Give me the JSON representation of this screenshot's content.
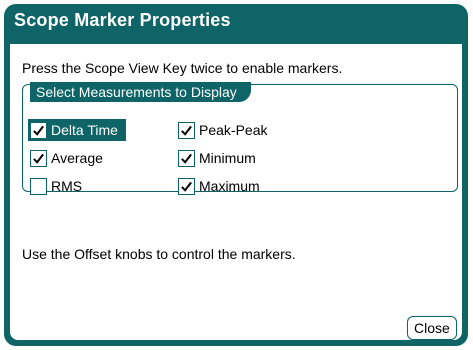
{
  "dialog": {
    "title": "Scope Marker Properties",
    "instruction": "Press the Scope View Key twice to enable markers.",
    "group_label": "Select Measurements to Display",
    "options": [
      {
        "label": "Delta Time",
        "checked": true,
        "selected": true
      },
      {
        "label": "Peak-Peak",
        "checked": true,
        "selected": false
      },
      {
        "label": "Average",
        "checked": true,
        "selected": false
      },
      {
        "label": "Minimum",
        "checked": true,
        "selected": false
      },
      {
        "label": "RMS",
        "checked": false,
        "selected": false
      },
      {
        "label": "Maximum",
        "checked": true,
        "selected": false
      }
    ],
    "footer_text": "Use the Offset knobs to control the markers.",
    "close_label": "Close"
  },
  "colors": {
    "accent": "#0e6466",
    "background": "#ffffff"
  },
  "icons": {
    "check": "check-icon"
  }
}
